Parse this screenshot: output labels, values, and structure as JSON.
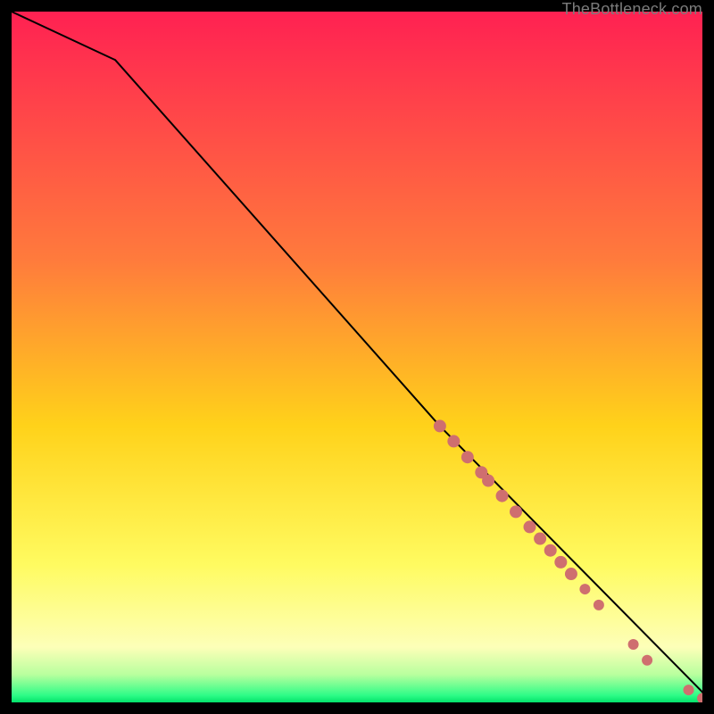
{
  "attribution": "TheBottleneck.com",
  "chart_data": {
    "type": "line",
    "title": "",
    "xlabel": "",
    "ylabel": "",
    "xlim": [
      0,
      100
    ],
    "ylim": [
      0,
      100
    ],
    "line": {
      "x": [
        0,
        15,
        62,
        100,
        100
      ],
      "y": [
        100,
        93,
        40,
        1.5,
        0.5
      ],
      "note": "percentage coords; curve is a monotone decreasing line with slight initial concavity and a final tiny hook at the right edge"
    },
    "points": {
      "cluster_along_line_x_range": [
        62,
        92
      ],
      "x": [
        62,
        64,
        66,
        68,
        69,
        71,
        73,
        75,
        76.5,
        78,
        79.5,
        81,
        83,
        85,
        90,
        92,
        98,
        100
      ],
      "y": [
        40,
        37.8,
        35.5,
        33.3,
        32.1,
        29.9,
        27.6,
        25.4,
        23.7,
        22.0,
        20.3,
        18.6,
        16.4,
        14.1,
        8.4,
        6.1,
        1.8,
        0.6
      ],
      "color": "#cf6f6f"
    },
    "background_gradient_stops": [
      {
        "pct": 0,
        "color": "#ff2152"
      },
      {
        "pct": 36,
        "color": "#ff7b3c"
      },
      {
        "pct": 60,
        "color": "#ffd21a"
      },
      {
        "pct": 80,
        "color": "#fffb60"
      },
      {
        "pct": 92,
        "color": "#fdffb8"
      },
      {
        "pct": 96,
        "color": "#b8ff9e"
      },
      {
        "pct": 99,
        "color": "#2dfc87"
      },
      {
        "pct": 100,
        "color": "#03e26a"
      }
    ]
  }
}
